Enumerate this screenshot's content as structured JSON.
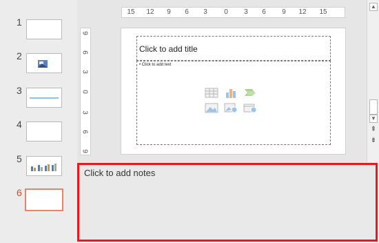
{
  "thumbnails": [
    {
      "number": "1",
      "kind": "blank",
      "active": false
    },
    {
      "number": "2",
      "kind": "picture",
      "active": false
    },
    {
      "number": "3",
      "kind": "line",
      "active": false
    },
    {
      "number": "4",
      "kind": "blank",
      "active": false
    },
    {
      "number": "5",
      "kind": "chart",
      "active": false
    },
    {
      "number": "6",
      "kind": "blank",
      "active": true
    }
  ],
  "ruler": {
    "horizontal": [
      "15",
      "12",
      "9",
      "6",
      "3",
      "0",
      "3",
      "6",
      "9",
      "12",
      "15"
    ],
    "vertical": [
      "9",
      "6",
      "3",
      "0",
      "3",
      "6",
      "9"
    ]
  },
  "slide": {
    "title_placeholder": "Click to add title",
    "body_placeholder": "• Click to add text",
    "content_icons": [
      "table-icon",
      "chart-icon",
      "smartart-icon",
      "picture-icon",
      "online-picture-icon",
      "video-icon"
    ]
  },
  "notes": {
    "placeholder": "Click to add notes"
  },
  "colors": {
    "active_thumb": "#d24726",
    "highlight": "#e11b22"
  }
}
